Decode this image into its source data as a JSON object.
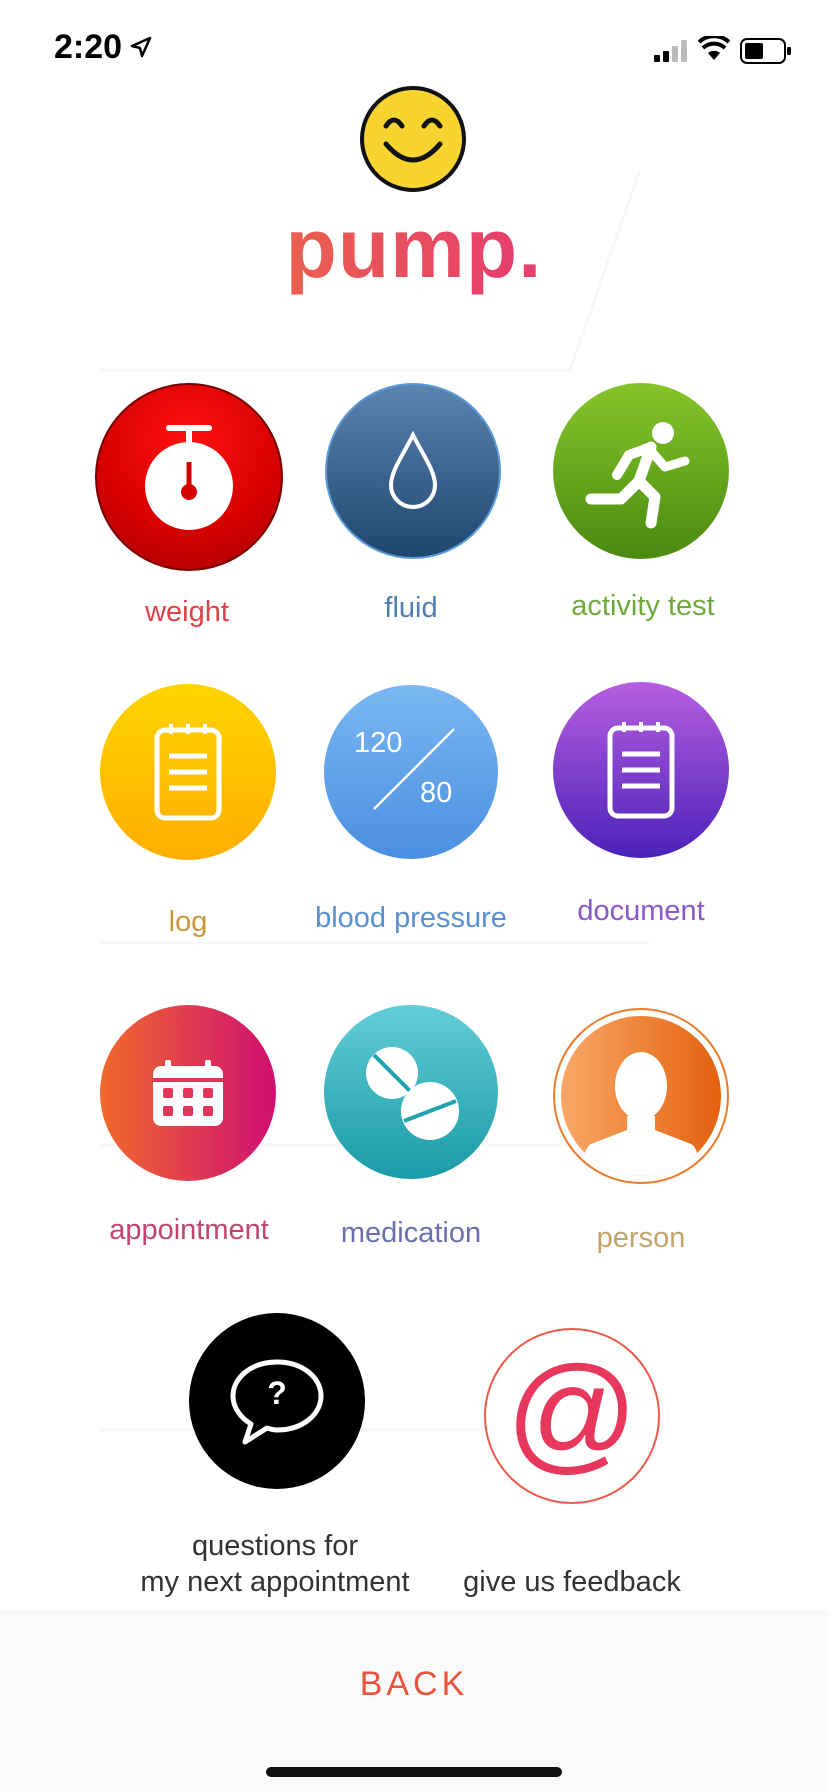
{
  "status_bar": {
    "time": "2:20"
  },
  "brand": {
    "name": "pump."
  },
  "tiles": {
    "weight": {
      "label": "weight",
      "color": "#e0404a"
    },
    "fluid": {
      "label": "fluid",
      "color": "#4d7fb0"
    },
    "activity_test": {
      "label": "activity test",
      "color": "#6eaa3a"
    },
    "log": {
      "label": "log",
      "color": "#c9973a"
    },
    "blood_pressure": {
      "label": "blood pressure",
      "systolic": "120",
      "diastolic": "80",
      "color": "#5a8fcf"
    },
    "document": {
      "label": "document",
      "color": "#8a57c8"
    },
    "appointment": {
      "label": "appointment",
      "color": "#c0476b"
    },
    "medication": {
      "label": "medication",
      "color": "#6a6fae"
    },
    "person": {
      "label": "person",
      "color": "#c2a36a"
    },
    "questions": {
      "label_line1": "questions for",
      "label_line2": "my next appointment",
      "symbol": "?"
    },
    "feedback": {
      "label": "give us feedback",
      "symbol": "@"
    }
  },
  "navigation": {
    "back_label": "BACK"
  },
  "icons": [
    "location-arrow-icon",
    "signal-icon",
    "wifi-icon",
    "battery-icon",
    "smiley-icon",
    "stopwatch-icon",
    "water-drop-icon",
    "running-person-icon",
    "clipboard-icon",
    "calendar-icon",
    "pills-icon",
    "person-silhouette-icon",
    "speech-bubble-icon",
    "at-sign-icon"
  ]
}
